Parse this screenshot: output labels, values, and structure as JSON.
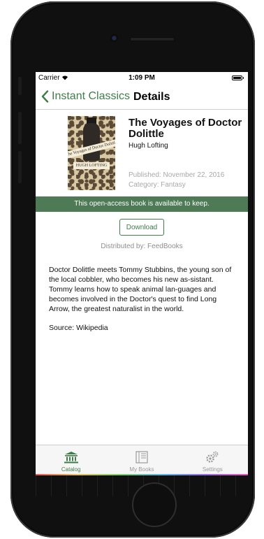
{
  "status_bar": {
    "carrier": "Carrier",
    "time": "1:09 PM"
  },
  "nav": {
    "back_label": "Instant Classics",
    "title": "Details"
  },
  "book": {
    "title": "The Voyages of Doctor Dolittle",
    "author": "Hugh Lofting",
    "published": "Published: November 22, 2016",
    "category": "Category: Fantasy"
  },
  "banner_text": "This open-access book is available to keep.",
  "download_label": "Download",
  "distributed_by": "Distributed by: FeedBooks",
  "summary": "Doctor Dolittle meets Tommy Stubbins, the young son of the local cobbler, who becomes his new as-sistant. Tommy learns how to speak animal lan-guages and becomes involved in the Doctor's quest to find Long Arrow, the greatest naturalist in the world.",
  "source": "Source: Wikipedia",
  "tabs": [
    {
      "label": "Catalog",
      "icon": "bank-icon",
      "active": true
    },
    {
      "label": "My Books",
      "icon": "books-icon",
      "active": false
    },
    {
      "label": "Settings",
      "icon": "gears-icon",
      "active": false
    }
  ],
  "colors": {
    "accent": "#3f7d4a",
    "banner": "#4e7b55",
    "muted": "#a8a8a8"
  }
}
